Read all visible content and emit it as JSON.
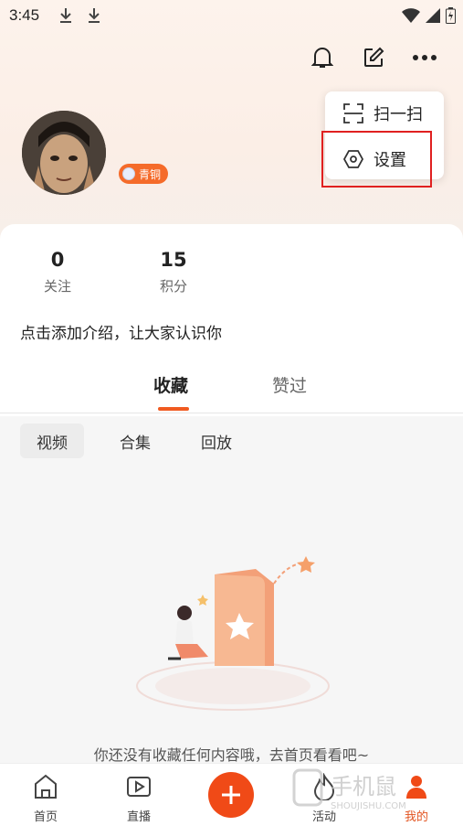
{
  "status_bar": {
    "time": "3:45"
  },
  "popup": {
    "items": [
      {
        "label": "扫一扫",
        "icon": "scan-icon"
      },
      {
        "label": "设置",
        "icon": "settings-icon"
      }
    ]
  },
  "profile": {
    "badge": "青铜",
    "stats": [
      {
        "value": "0",
        "label": "关注"
      },
      {
        "value": "15",
        "label": "积分"
      }
    ],
    "intro": "点击添加介绍，让大家认识你"
  },
  "tabs": {
    "main": [
      "收藏",
      "赞过"
    ],
    "sub": [
      "视频",
      "合集",
      "回放"
    ]
  },
  "empty_state": {
    "message": "你还没有收藏任何内容哦，去首页看看吧~"
  },
  "bottom_nav": {
    "items": [
      {
        "label": "首页",
        "icon": "home-icon"
      },
      {
        "label": "直播",
        "icon": "live-icon"
      },
      {
        "label": "活动",
        "icon": "activity-icon"
      },
      {
        "label": "我的",
        "icon": "me-icon"
      }
    ]
  },
  "watermark": {
    "text": "手机鼠",
    "subtext": "SHOUJISHU.COM"
  },
  "colors": {
    "accent": "#f05a20",
    "badge": "#f56b2a",
    "highlight_border": "#e02020"
  }
}
